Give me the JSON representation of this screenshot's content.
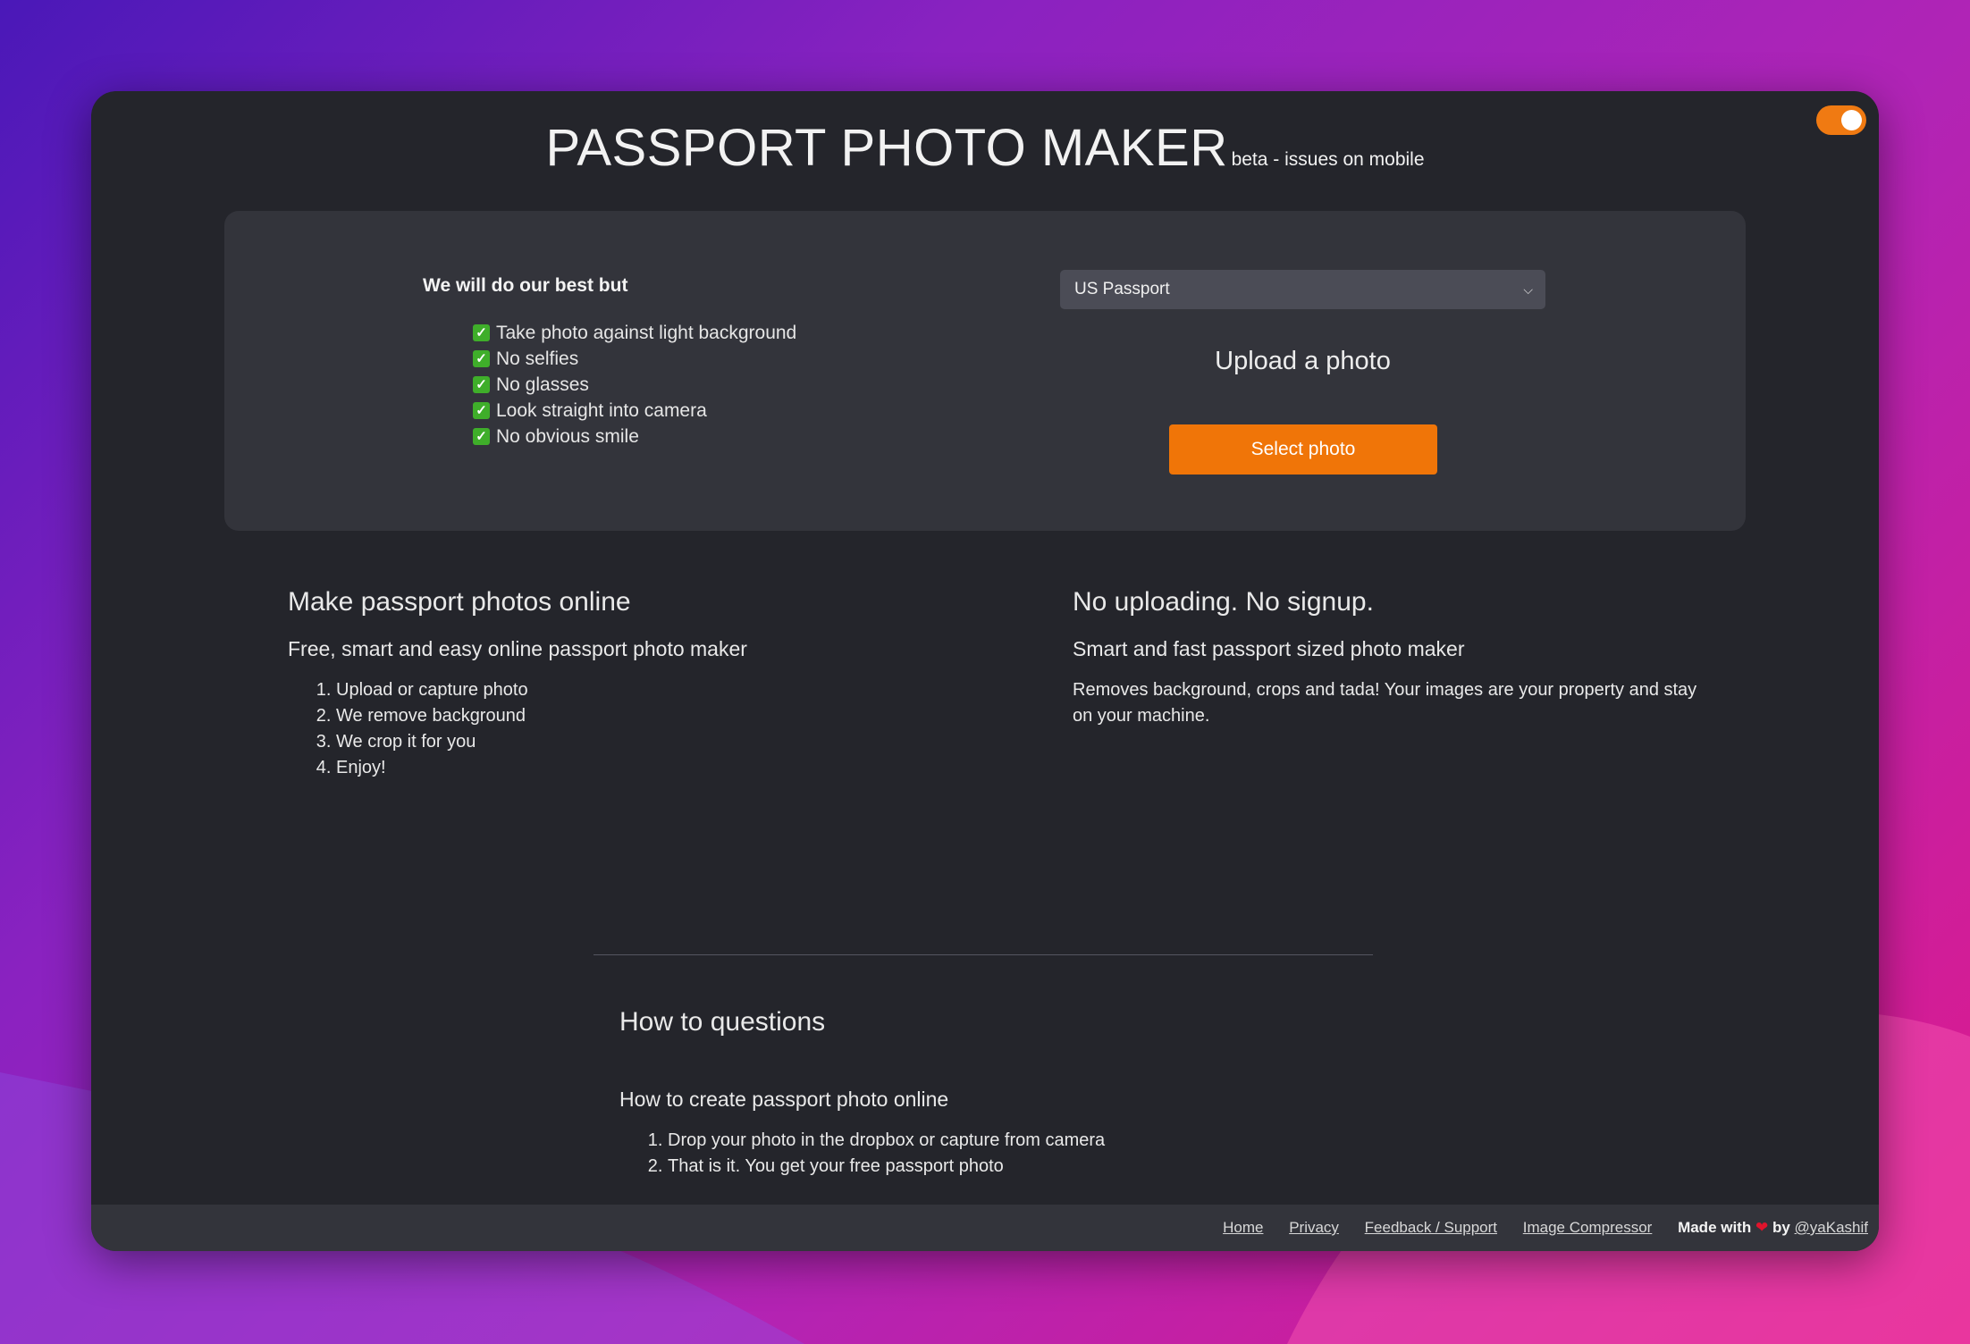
{
  "app": {
    "title": "PASSPORT PHOTO MAKER",
    "subtitle": "beta - issues on mobile",
    "theme_toggle": {
      "state": "on",
      "color": "#f07a12"
    }
  },
  "upload_panel": {
    "tips_heading": "We will do our best but",
    "tips": [
      "Take photo against light background",
      "No selfies",
      "No glasses",
      "Look straight into camera",
      "No obvious smile"
    ],
    "document_select": {
      "selected": "US Passport"
    },
    "upload_label": "Upload a photo",
    "select_button_label": "Select photo",
    "accent_color": "#f07508"
  },
  "info_left": {
    "heading": "Make passport photos online",
    "subheading": "Free, smart and easy online passport photo maker",
    "steps": [
      "Upload or capture photo",
      "We remove background",
      "We crop it for you",
      "Enjoy!"
    ]
  },
  "info_right": {
    "heading": "No uploading. No signup.",
    "subheading": "Smart and fast passport sized photo maker",
    "body": "Removes background, crops and tada! Your images are your property and stay on your machine."
  },
  "faq": {
    "heading": "How to questions",
    "question": "How to create passport photo online",
    "steps": [
      "Drop your photo in the dropbox or capture from camera",
      "That is it. You get your free passport photo"
    ]
  },
  "footer": {
    "links": {
      "home": "Home",
      "privacy": "Privacy",
      "feedback": "Feedback / Support",
      "image_compressor": "Image Compressor"
    },
    "made_with": "Made with",
    "by": "by",
    "author": "@yaKashif",
    "heart_icon": "heart-icon"
  }
}
